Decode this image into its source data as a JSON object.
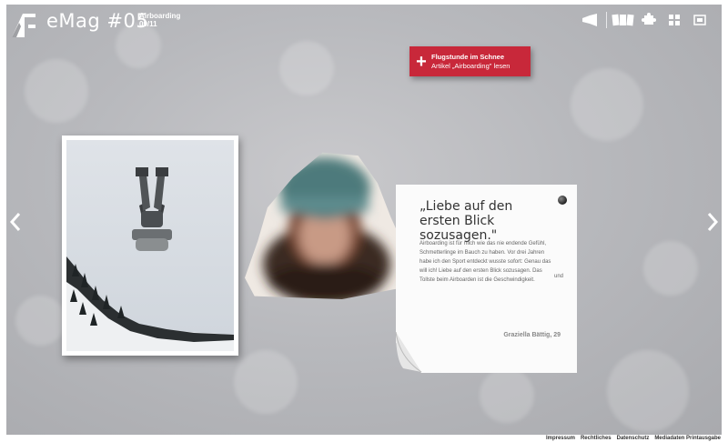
{
  "app": {
    "brand": "eMag #05",
    "issue_topic": "Airboarding",
    "issue_date": "09/11",
    "logo_icon": "brand-logo-icon"
  },
  "toolbar": {
    "items": [
      {
        "name": "megaphone-icon"
      },
      {
        "name": "pages-overview-icon"
      },
      {
        "name": "puzzle-icon"
      },
      {
        "name": "grid-icon"
      },
      {
        "name": "fullscreen-icon"
      }
    ]
  },
  "cta": {
    "icon": "+",
    "title": "Flugstunde im Schnee",
    "subtitle": "Artikel „Airboarding\" lesen",
    "color": "#c8283a"
  },
  "navigation": {
    "prev_icon": "chevron-left-icon",
    "next_icon": "chevron-right-icon"
  },
  "quote_card": {
    "title": "„Liebe auf den ersten Blick sozusagen.\"",
    "body": "Airboarding ist für mich wie das nie endende Gefühl, Schmetterlinge im Bauch zu haben. Vor drei Jahren habe ich den Sport entdeckt wusste sofort: Genau das will ich! Liebe auf den ersten Blick sozusagen. Das Tollste beim Airboarden ist die Geschwindigkeit.",
    "stray_word": "und",
    "author": "Graziella Bättig, 29"
  },
  "footer": {
    "links": [
      "Impressum",
      "Rechtliches",
      "Datenschutz",
      "Mediadaten Printausgabe"
    ]
  }
}
